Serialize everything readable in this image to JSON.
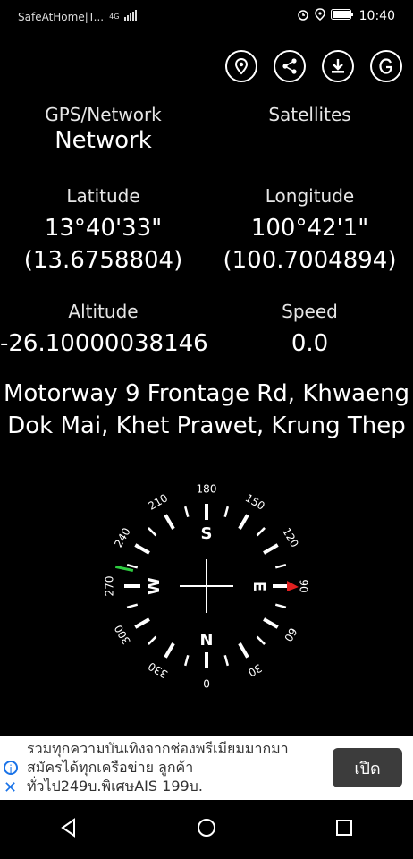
{
  "status_bar": {
    "notification_text": "SafeAtHome|T...",
    "network_type": "4G",
    "time": "10:40"
  },
  "toolbar": {
    "icons": [
      "location-pin-icon",
      "share-icon",
      "download-icon",
      "google-icon"
    ]
  },
  "source": {
    "label": "GPS/Network",
    "value": "Network"
  },
  "satellites": {
    "label": "Satellites",
    "value": ""
  },
  "latitude": {
    "label": "Latitude",
    "dms": "13°40'33\"",
    "decimal": "(13.6758804)"
  },
  "longitude": {
    "label": "Longitude",
    "dms": "100°42'1\"",
    "decimal": "(100.7004894)"
  },
  "altitude": {
    "label": "Altitude",
    "value": "-26.10000038146"
  },
  "speed": {
    "label": "Speed",
    "value": "0.0"
  },
  "address": {
    "line1": "Motorway 9 Frontage Rd, Khwaeng",
    "line2": "Dok Mai, Khet Prawet, Krung Thep"
  },
  "compass": {
    "heading_labels": [
      "0",
      "30",
      "60",
      "90",
      "120",
      "150",
      "180",
      "210",
      "240",
      "270",
      "300",
      "330"
    ],
    "cardinals": {
      "N": "N",
      "E": "E",
      "S": "S",
      "W": "W"
    },
    "marker_color": "#2ecc40",
    "pointer_color": "#e02020"
  },
  "ad": {
    "line1": "รวมทุกความบันเทิงจากช่องพรีเมียมมากมา",
    "line2": "สมัครได้ทุกเครือข่าย ลูกค้า",
    "line3": "ทั่วไป249บ.พิเศษAIS 199บ.",
    "button": "เปิด",
    "info_icon": "i",
    "close_icon": "✕"
  },
  "navbar": {
    "icons": [
      "back-icon",
      "home-icon",
      "recents-icon"
    ]
  }
}
